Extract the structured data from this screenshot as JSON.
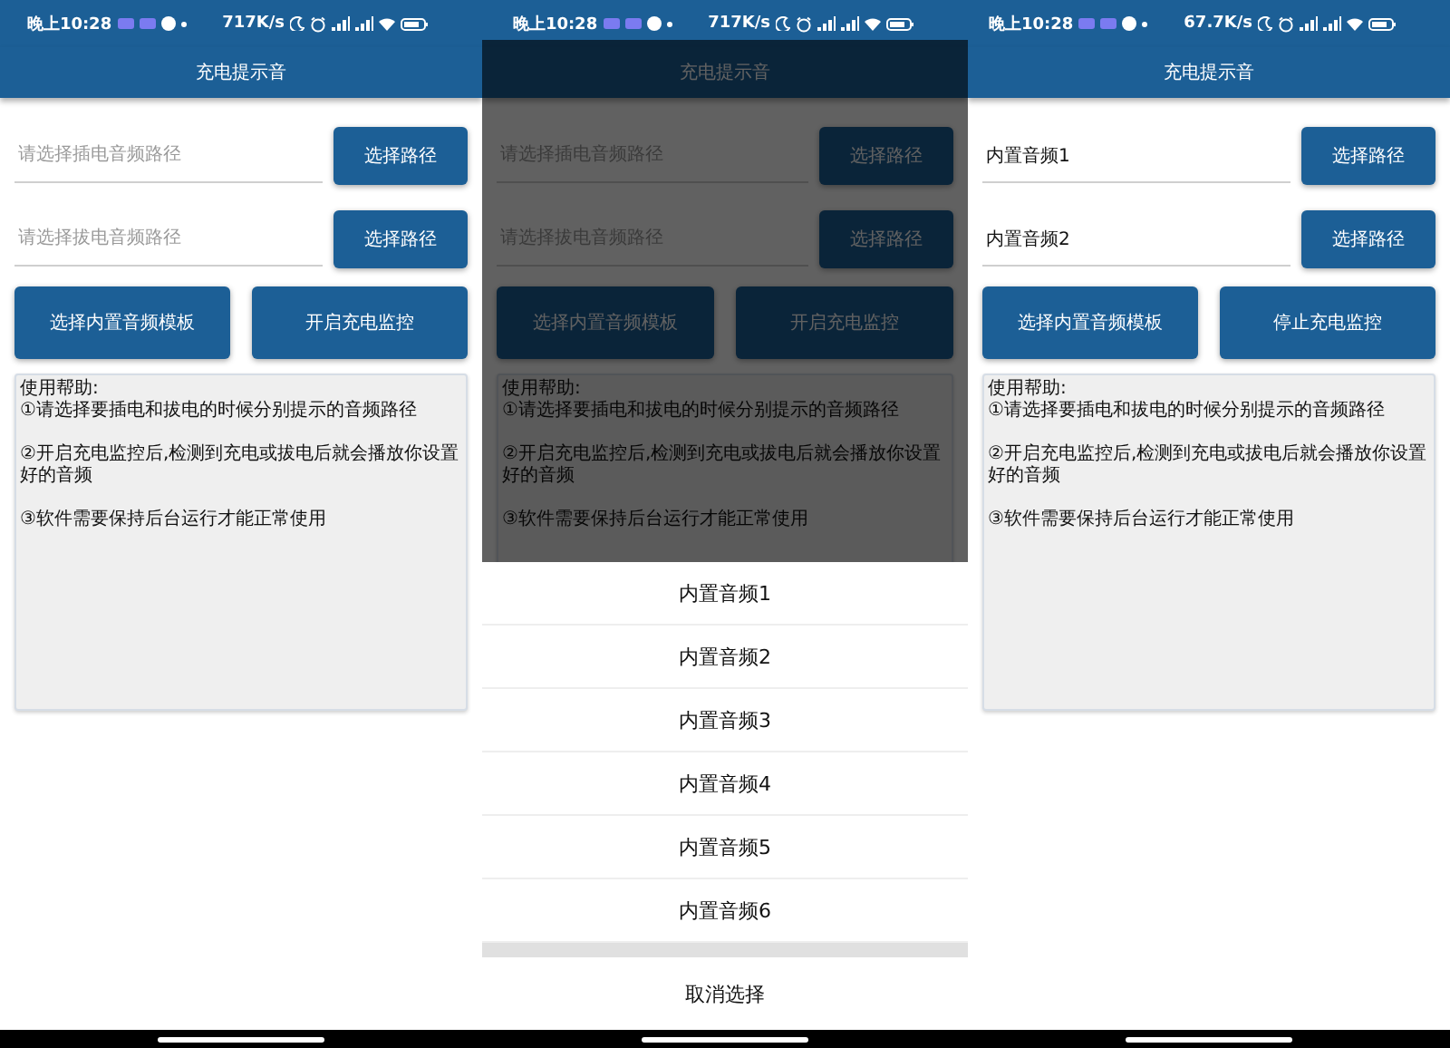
{
  "screens": [
    {
      "status_bar": {
        "time": "晚上10:28",
        "speed": "717K/s"
      },
      "title": "充电提示音",
      "fields": [
        {
          "placeholder": "请选择插电音频路径",
          "button": "选择路径"
        },
        {
          "placeholder": "请选择拔电音频路径",
          "button": "选择路径"
        }
      ],
      "buttons": [
        "选择内置音频模板",
        "开启充电监控"
      ],
      "help": {
        "title": "使用帮助:",
        "items": [
          "①请选择要插电和拔电的时候分别提示的音频路径",
          "②开启充电监控后,检测到充电或拔电后就会播放你设置好的音频",
          "③软件需要保持后台运行才能正常使用"
        ]
      }
    },
    {
      "status_bar": {
        "time": "晚上10:28",
        "speed": "717K/s"
      },
      "title": "充电提示音",
      "fields": [
        {
          "placeholder": "请选择插电音频路径",
          "button": "选择路径"
        },
        {
          "placeholder": "请选择拔电音频路径",
          "button": "选择路径"
        }
      ],
      "buttons": [
        "选择内置音频模板",
        "开启充电监控"
      ],
      "help": {
        "title": "使用帮助:",
        "items": [
          "①请选择要插电和拔电的时候分别提示的音频路径",
          "②开启充电监控后,检测到充电或拔电后就会播放你设置好的音频",
          "③软件需要保持后台运行才能正常使用"
        ]
      },
      "sheet": {
        "options": [
          "内置音频1",
          "内置音频2",
          "内置音频3",
          "内置音频4",
          "内置音频5",
          "内置音频6"
        ],
        "cancel": "取消选择"
      }
    },
    {
      "status_bar": {
        "time": "晚上10:28",
        "speed": "67.7K/s"
      },
      "title": "充电提示音",
      "fields": [
        {
          "value": "内置音频1",
          "button": "选择路径"
        },
        {
          "value": "内置音频2",
          "button": "选择路径"
        }
      ],
      "buttons": [
        "选择内置音频模板",
        "停止充电监控"
      ],
      "help": {
        "title": "使用帮助:",
        "items": [
          "①请选择要插电和拔电的时候分别提示的音频路径",
          "②开启充电监控后,检测到充电或拔电后就会播放你设置好的音频",
          "③软件需要保持后台运行才能正常使用"
        ]
      }
    }
  ]
}
